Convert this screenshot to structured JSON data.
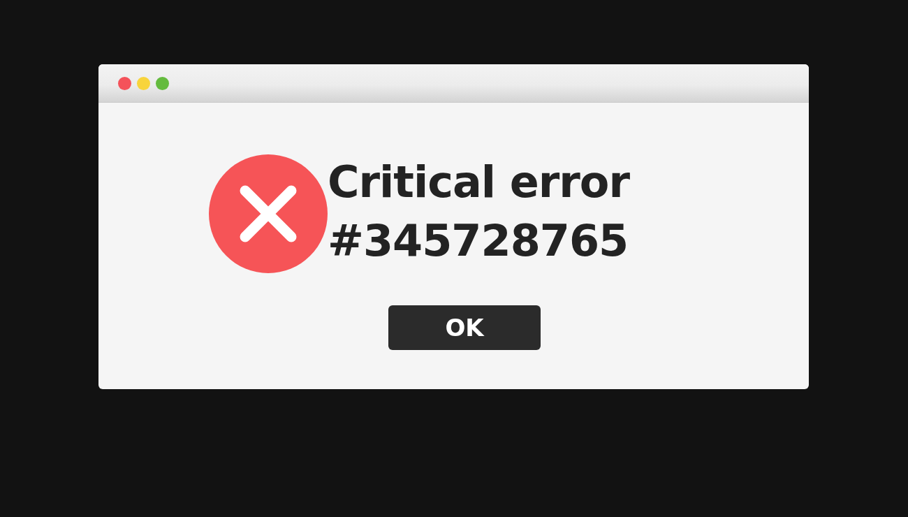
{
  "window": {
    "controls": [
      {
        "color": "#f4525a"
      },
      {
        "color": "#f8d43c"
      },
      {
        "color": "#64bb3e"
      }
    ]
  },
  "dialog": {
    "kind": "error",
    "message": [
      "Critical error",
      "#345728765"
    ],
    "buttons": [
      "OK"
    ]
  }
}
